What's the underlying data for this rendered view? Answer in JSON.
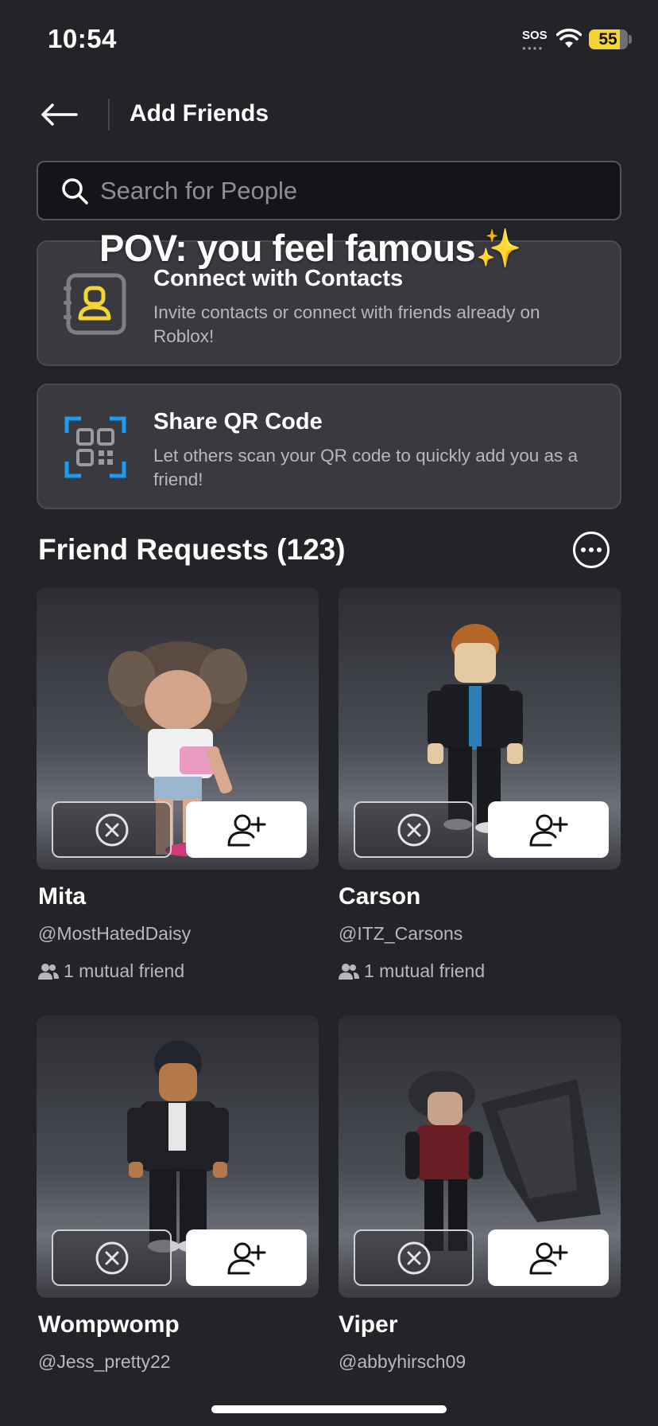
{
  "status_bar": {
    "time": "10:54",
    "sos": "SOS",
    "battery": "55"
  },
  "header": {
    "title": "Add Friends",
    "back_icon": "arrow-left-icon"
  },
  "search": {
    "placeholder": "Search for People"
  },
  "overlay_caption": {
    "text": "POV: you feel famous",
    "emoji": "✨"
  },
  "options": {
    "contacts": {
      "title": "Connect with Contacts",
      "description": "Invite contacts or connect with friends already on Roblox!",
      "icon": "contact-book-icon"
    },
    "qr": {
      "title": "Share QR Code",
      "description": "Let others scan your QR code to quickly add you as a friend!",
      "icon": "qr-code-icon"
    }
  },
  "friend_requests": {
    "title": "Friend Requests (123)",
    "more_icon": "more-options-icon",
    "items": [
      {
        "name": "Mita",
        "handle": "@MostHatedDaisy",
        "mutual": "1 mutual friend"
      },
      {
        "name": "Carson",
        "handle": "@ITZ_Carsons",
        "mutual": "1 mutual friend"
      },
      {
        "name": "Wompwomp",
        "handle": "@Jess_pretty22",
        "mutual": ""
      },
      {
        "name": "Viper",
        "handle": "@abbyhirsch09",
        "mutual": ""
      }
    ]
  },
  "colors": {
    "background": "#232428",
    "card": "#393a40",
    "accent_yellow": "#f5d532",
    "qr_blue": "#1d9bf0"
  }
}
